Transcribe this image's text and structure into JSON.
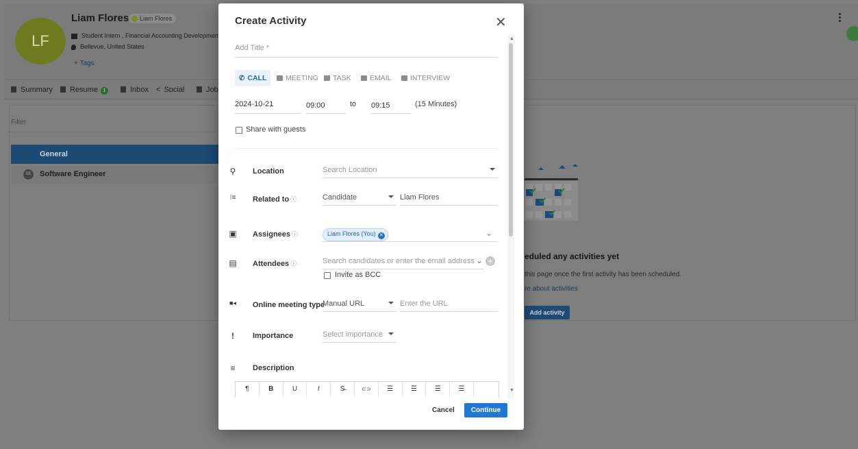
{
  "candidate": {
    "initials": "LF",
    "name": "Liam Flores",
    "owner_tag": "Liam Flores",
    "job": "Student Intern , Financial Accounting Development",
    "location": "Bellevue, United States",
    "tags_link": "+ Tags"
  },
  "tabs": {
    "summary": "Summary",
    "resume": "Resume",
    "resume_badge": "1",
    "inbox": "Inbox",
    "social": "Social",
    "jobs": "Job"
  },
  "left_panel": {
    "filter_placeholder": "Filter",
    "general": "General",
    "job_item": "Software Engineer",
    "job_badge": "SE"
  },
  "empty_state": {
    "title": "eduled any activities yet",
    "subtitle": "this page once the first activity has been scheduled.",
    "link": "re about activities",
    "button": "Add activity"
  },
  "modal": {
    "title": "Create Activity",
    "close": "✕",
    "title_placeholder": "Add Title *",
    "types": [
      "CALL",
      "MEETING",
      "TASK",
      "EMAIL",
      "INTERVIEW"
    ],
    "active_type": "CALL",
    "date": "2024-10-21",
    "start_time": "09:00",
    "to": "to",
    "end_time": "09:15",
    "duration": "(15 Minutes)",
    "share_with_guests": "Share with guests",
    "location_label": "Location",
    "location_placeholder": "Search Location",
    "related_label": "Related to",
    "related_type": "Candidate",
    "related_value": "Liam Flores",
    "assignees_label": "Assignees",
    "assignee_chip": "Liam Flores (You)",
    "attendees_label": "Attendees",
    "attendees_placeholder": "Search candidates or enter the email address",
    "invite_bcc": "Invite as BCC",
    "online_label": "Online meeting type",
    "online_type": "Manual URL",
    "url_placeholder": "Enter the URL",
    "importance_label": "Importance",
    "importance_placeholder": "Select importance",
    "description_label": "Description",
    "toolbar": [
      "¶",
      "B",
      "U",
      "I",
      "S̶",
      "⊂⊃",
      "☰",
      "☰",
      "☰",
      "☰",
      ""
    ],
    "cancel": "Cancel",
    "continue": "Continue"
  },
  "colors": {
    "accent": "#1f78d1",
    "chip_bg": "#e2eefa",
    "overlay": "#7e7e7e"
  }
}
